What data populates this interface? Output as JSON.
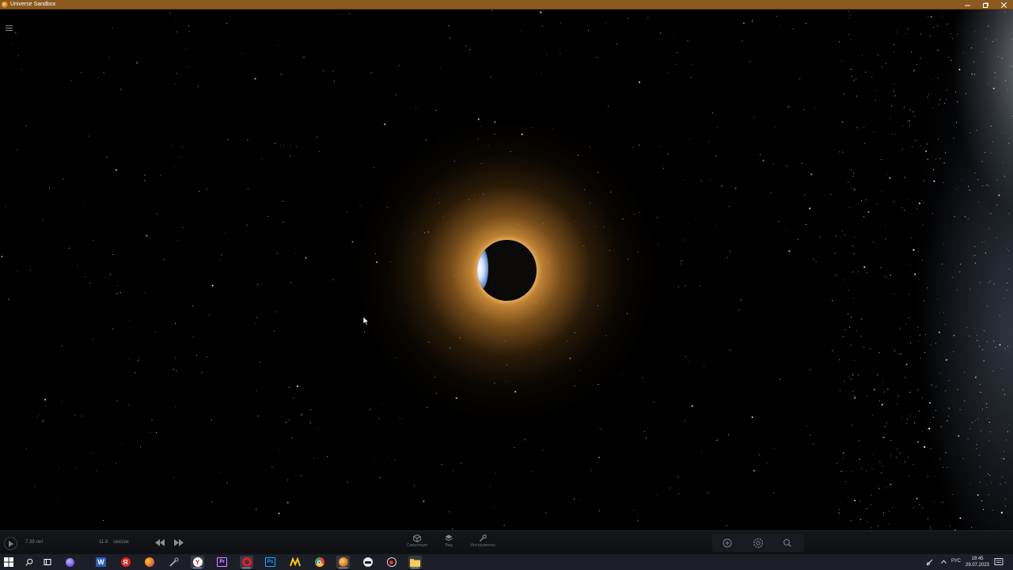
{
  "window": {
    "title": "Universe Sandbox",
    "controls": [
      "minimize-icon",
      "restore-icon",
      "close-icon"
    ]
  },
  "colors": {
    "titlebar": "#8a5a1e",
    "glow": "#f6aa46",
    "panel": "#141519",
    "taskbar": "#1c1f27"
  },
  "viewport": {
    "menu_icon": "hamburger-icon",
    "planet_icon": "eclipsed-planet"
  },
  "bottom_bar": {
    "elapsed_time": "7.39 лет",
    "speed_value": "11.8",
    "speed_unit": "сек/сек",
    "tools": [
      {
        "label": "Симуляция",
        "icon": "cube-icon"
      },
      {
        "label": "Вид",
        "icon": "layers-icon"
      },
      {
        "label": "Инструменты",
        "icon": "wrench-icon"
      }
    ],
    "right_icons": [
      "add-icon",
      "settings-icon",
      "search-icon"
    ]
  },
  "taskbar": {
    "apps": [
      {
        "name": "start",
        "icon": "windows-icon"
      },
      {
        "name": "search",
        "icon": "search-icon"
      },
      {
        "name": "task-view",
        "icon": "task-view-icon"
      },
      {
        "name": "app-purple",
        "icon": "circle-app-icon"
      },
      {
        "name": "word",
        "icon": "word-icon",
        "letter": "W"
      },
      {
        "name": "yandex",
        "icon": "yandex-icon",
        "letter": "Я"
      },
      {
        "name": "firefox",
        "icon": "firefox-icon"
      },
      {
        "name": "tool",
        "icon": "tool-icon"
      },
      {
        "name": "yandex-browser",
        "icon": "yandex-browser-icon",
        "letter": "Y"
      },
      {
        "name": "premiere",
        "icon": "premiere-icon",
        "letter": "Pr"
      },
      {
        "name": "opera",
        "icon": "opera-icon"
      },
      {
        "name": "photoshop",
        "icon": "photoshop-icon",
        "letter": "Ps"
      },
      {
        "name": "app-yellow",
        "icon": "yellow-app-icon"
      },
      {
        "name": "chrome",
        "icon": "chrome-icon"
      },
      {
        "name": "universe-sandbox",
        "icon": "universe-sandbox-icon"
      },
      {
        "name": "app-dark",
        "icon": "dark-app-icon"
      },
      {
        "name": "app-red",
        "icon": "red-app-icon"
      },
      {
        "name": "explorer",
        "icon": "folder-icon"
      }
    ],
    "tray": {
      "lang": "РУС",
      "time": "19:45",
      "date": "29.07.2023"
    }
  }
}
